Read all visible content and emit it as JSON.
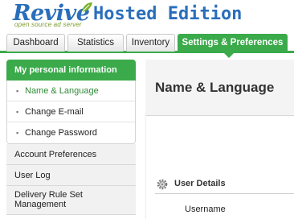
{
  "brand": {
    "logo_text": "Revive",
    "logo_tagline": "open source ad server",
    "edition": "Hosted Edition"
  },
  "tabs": [
    {
      "label": "Dashboard",
      "active": false
    },
    {
      "label": "Statistics",
      "active": false
    },
    {
      "label": "Inventory",
      "active": false
    },
    {
      "label": "Settings & Preferences",
      "active": true
    }
  ],
  "sidebar": {
    "header": "My personal information",
    "subitems": [
      {
        "label": "Name & Language",
        "current": true
      },
      {
        "label": "Change E-mail",
        "current": false
      },
      {
        "label": "Change Password",
        "current": false
      }
    ],
    "items": [
      {
        "label": "Account Preferences"
      },
      {
        "label": "User Log"
      },
      {
        "label": "Delivery Rule Set Management"
      }
    ]
  },
  "main": {
    "title": "Name & Language",
    "section": "User Details",
    "field_username": "Username"
  },
  "colors": {
    "accent_green": "#3aaa4a",
    "brand_blue": "#2a6ebb",
    "tagline_green": "#7a9c2a"
  }
}
